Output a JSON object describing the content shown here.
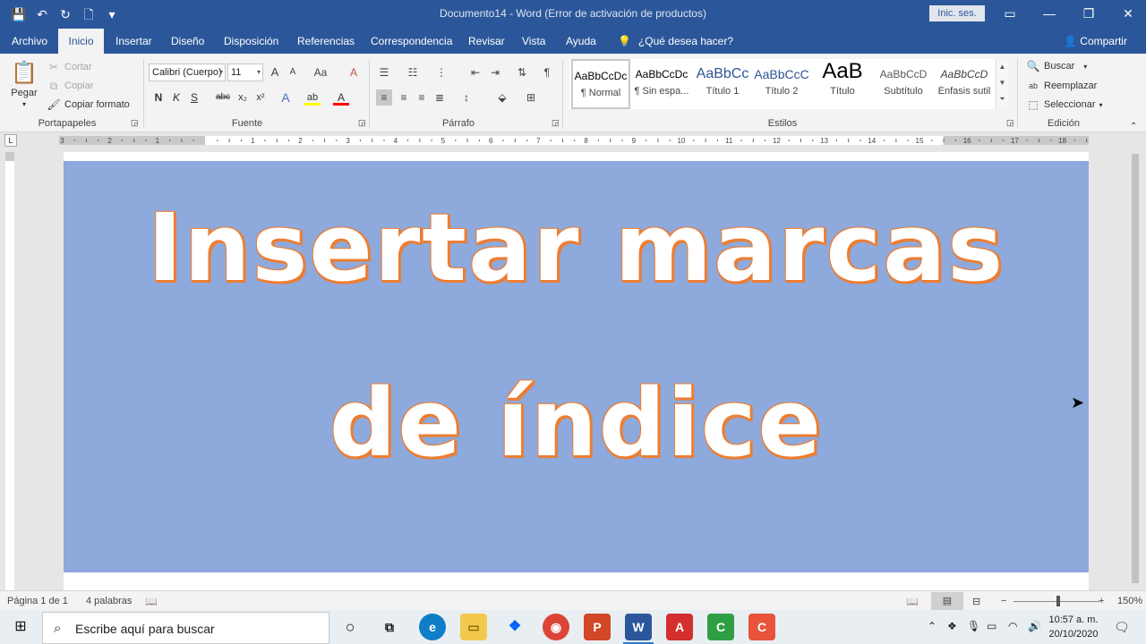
{
  "window": {
    "title": "Documento14  -  Word (Error de activación de productos)",
    "signin_label": "Inic. ses.",
    "controls": {
      "ribbon_display": "▭",
      "minimize": "—",
      "restore": "❐",
      "close": "✕"
    }
  },
  "qat": {
    "save": "💾",
    "undo": "↶",
    "redo": "↻",
    "new": "🗋",
    "customize": "▾"
  },
  "tabs": [
    "Archivo",
    "Inicio",
    "Insertar",
    "Diseño",
    "Disposición",
    "Referencias",
    "Correspondencia",
    "Revisar",
    "Vista",
    "Ayuda"
  ],
  "active_tab": "Inicio",
  "tell_me": "¿Qué desea hacer?",
  "share_label": "Compartir",
  "ribbon": {
    "clipboard": {
      "label": "Portapapeles",
      "paste": "Pegar",
      "cut": "Cortar",
      "copy": "Copiar",
      "format_painter": "Copiar formato"
    },
    "font": {
      "label": "Fuente",
      "font_name": "Calibri (Cuerpo)",
      "font_size": "11",
      "bold": "N",
      "italic": "K",
      "underline": "S",
      "strike": "abc",
      "subscript": "x₂",
      "superscript": "x²",
      "grow": "A",
      "shrink": "A",
      "case": "Aa",
      "clear": "A",
      "effects": "A",
      "highlight": "ab",
      "color": "A"
    },
    "paragraph": {
      "label": "Párrafo",
      "pilcrow": "¶"
    },
    "styles": {
      "label": "Estilos",
      "items": [
        {
          "preview": "AaBbCcDc",
          "name": "¶ Normal"
        },
        {
          "preview": "AaBbCcDc",
          "name": "¶ Sin espa..."
        },
        {
          "preview": "AaBbCc",
          "name": "Título 1"
        },
        {
          "preview": "AaBbCcC",
          "name": "Título 2"
        },
        {
          "preview": "AaB",
          "name": "Título"
        },
        {
          "preview": "AaBbCcD",
          "name": "Subtítulo"
        },
        {
          "preview": "AaBbCcD",
          "name": "Énfasis sutil"
        }
      ]
    },
    "editing": {
      "label": "Edición",
      "find": "Buscar",
      "replace": "Reemplazar",
      "select": "Seleccionar"
    }
  },
  "ruler": {
    "tab_selector": "L",
    "numbers": [
      "3",
      "2",
      "1",
      "1",
      "2",
      "3",
      "4",
      "5",
      "6",
      "7",
      "8",
      "9",
      "10",
      "11",
      "12",
      "13",
      "14",
      "15",
      "16",
      "17",
      "18"
    ]
  },
  "document": {
    "heading_line1": "Insertar marcas",
    "heading_line2": "de índice",
    "banner_color": "#8ea9db",
    "outline_color": "#ed7d31"
  },
  "status": {
    "page": "Página 1 de 1",
    "words": "4 palabras",
    "zoom": "150%",
    "minus": "−",
    "plus": "+"
  },
  "taskbar": {
    "search_placeholder": "Escribe aquí para buscar",
    "time": "10:57 a. m.",
    "date": "20/10/2020",
    "apps": [
      "Cortana",
      "Vista de tareas",
      "Edge",
      "Explorador",
      "Dropbox",
      "Chrome",
      "PowerPoint",
      "Word",
      "Acrobat",
      "Camtasia",
      "Camtasia Recorder"
    ]
  },
  "colors": {
    "accent": "#2b579a",
    "ribbon": "#f3f3f3"
  }
}
